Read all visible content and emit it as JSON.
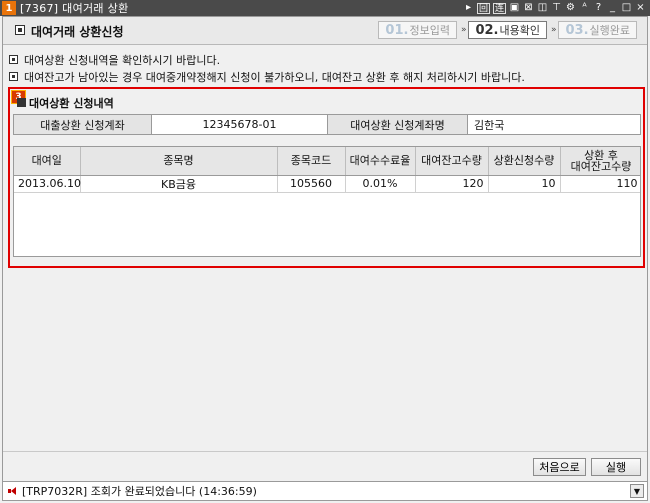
{
  "window": {
    "app_number": "1",
    "title": "[7367] 대여거래 상환",
    "tools": [
      "▸",
      "回",
      "连",
      "▣",
      "⊠",
      "◫",
      "⊤",
      "⚙",
      "ᴬ",
      "?",
      "_",
      "□",
      "×"
    ]
  },
  "header": {
    "title": "대여거래 상환신청",
    "steps": [
      {
        "num": "01.",
        "label": "정보입력"
      },
      {
        "num": "02.",
        "label": "내용확인"
      },
      {
        "num": "03.",
        "label": "실행완료"
      }
    ],
    "arrow": "»"
  },
  "notices": [
    "대여상환 신청내역을 확인하시기 바랍니다.",
    "대여잔고가 남아있는 경우 대여중개약정해지 신청이 불가하오니, 대여잔고 상환 후 해지 처리하시기 바랍니다."
  ],
  "section": {
    "badge": "3",
    "title": "대여상환 신청내역",
    "account_label": "대출상환 신청계좌",
    "account_value": "12345678-01",
    "account_name_label": "대여상환 신청계좌명",
    "account_name_value": "김한국"
  },
  "table": {
    "columns": [
      "대여일",
      "종목명",
      "종목코드",
      "대여수수료율",
      "대여잔고수량",
      "상환신청수량",
      "상환 후\n대여잔고수량"
    ],
    "rows": [
      [
        "2013.06.10",
        "KB금융",
        "105560",
        "0.01%",
        "120",
        "10",
        "110"
      ]
    ]
  },
  "buttons": {
    "first": "처음으로",
    "execute": "실행"
  },
  "status": {
    "message": "[TRP7032R] 조회가 완료되었습니다 (14:36:59)",
    "dropdown": "▼"
  },
  "colors": {
    "titlebar": "#4a4a4a",
    "app_number": "#e8730a",
    "section_border": "#e00000",
    "badge": "#d83a00"
  }
}
